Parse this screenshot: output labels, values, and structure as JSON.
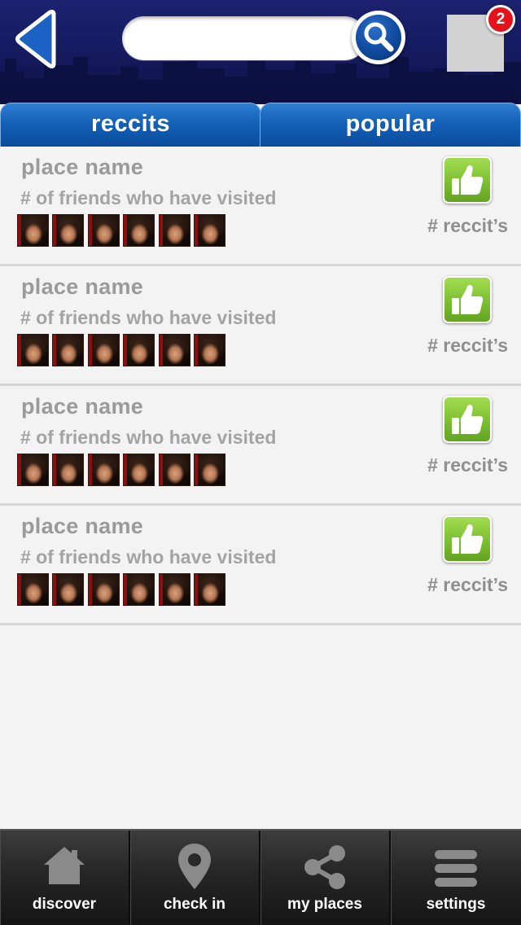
{
  "header": {
    "back_icon": "back-arrow-icon",
    "search": {
      "placeholder": "",
      "value": "",
      "icon": "search-icon"
    },
    "notifications": {
      "count": "2",
      "badge_color": "#e3121b"
    }
  },
  "tabs": [
    {
      "label": "reccits"
    },
    {
      "label": "popular"
    }
  ],
  "places": [
    {
      "name": "place name",
      "friends": "# of friends who have visited",
      "reccits": "# reccit’s"
    },
    {
      "name": "place name",
      "friends": "# of friends who have visited",
      "reccits": "# reccit’s"
    },
    {
      "name": "place name",
      "friends": "# of friends who have visited",
      "reccits": "# reccit’s"
    },
    {
      "name": "place name",
      "friends": "# of friends who have visited",
      "reccits": "# reccit’s"
    }
  ],
  "bottom_nav": [
    {
      "label": "discover",
      "icon": "home-icon"
    },
    {
      "label": "check in",
      "icon": "map-pin-icon"
    },
    {
      "label": "my places",
      "icon": "share-icon"
    },
    {
      "label": "settings",
      "icon": "menu-icon"
    }
  ],
  "colors": {
    "header_bg": "#141a5c",
    "tab_blue": "#1461b8",
    "like_green": "#7fc233",
    "text_gray": "#9a9a9a",
    "nav_bg": "#262626"
  }
}
